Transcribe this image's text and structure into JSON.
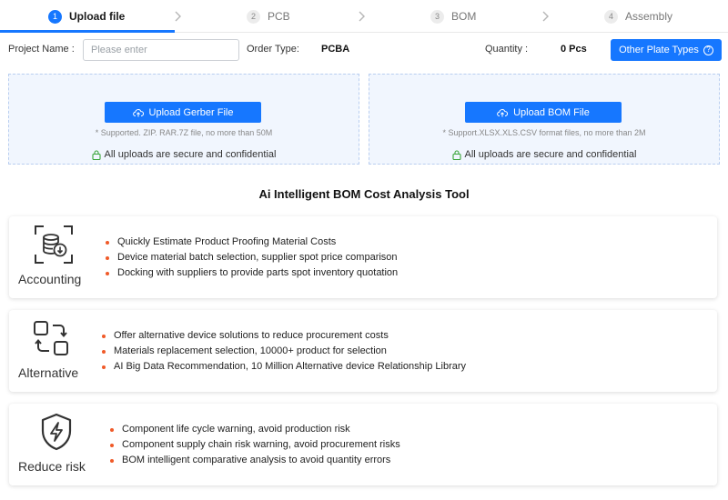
{
  "stepper": {
    "steps": [
      {
        "num": "1",
        "label": "Upload file"
      },
      {
        "num": "2",
        "label": "PCB"
      },
      {
        "num": "3",
        "label": "BOM"
      },
      {
        "num": "4",
        "label": "Assembly"
      }
    ],
    "active_step": 1
  },
  "form": {
    "project_name_label": "Project Name :",
    "project_name_placeholder": "Please enter",
    "project_name_value": "",
    "order_type_label": "Order Type:",
    "order_type_value": "PCBA",
    "quantity_label": "Quantity :",
    "quantity_value": "0 Pcs",
    "other_plate_button": "Other Plate Types"
  },
  "uploads": [
    {
      "button": "Upload Gerber File",
      "hint": "* Supported. ZIP. RAR.7Z file, no more than 50M",
      "secure": "All uploads are secure and confidential"
    },
    {
      "button": "Upload BOM File",
      "hint": "* Support.XLSX.XLS.CSV format files, no more than 2M",
      "secure": "All uploads are secure and confidential"
    }
  ],
  "section_title": "Ai Intelligent BOM Cost Analysis Tool",
  "features": [
    {
      "icon": "database-download-icon",
      "title": "Accounting",
      "items": [
        "Quickly Estimate Product Proofing Material Costs",
        "Device material batch selection, supplier spot price comparison",
        "Docking with suppliers to provide parts spot inventory quotation"
      ]
    },
    {
      "icon": "swap-alternative-icon",
      "title": "Alternative",
      "items": [
        "Offer alternative device solutions to reduce procurement costs",
        "Materials replacement selection, 10000+ product for selection",
        "AI Big Data Recommendation, 10 Million Alternative device Relationship Library"
      ]
    },
    {
      "icon": "shield-lightning-icon",
      "title": "Reduce risk",
      "items": [
        "Component life cycle warning, avoid production risk",
        "Component supply chain risk warning, avoid procurement risks",
        "BOM intelligent comparative analysis to avoid quantity errors"
      ]
    }
  ],
  "colors": {
    "primary": "#1677ff",
    "bullet": "#f05a28",
    "secure_lock": "#3aa53a",
    "panel_bg": "#f1f6fe"
  }
}
